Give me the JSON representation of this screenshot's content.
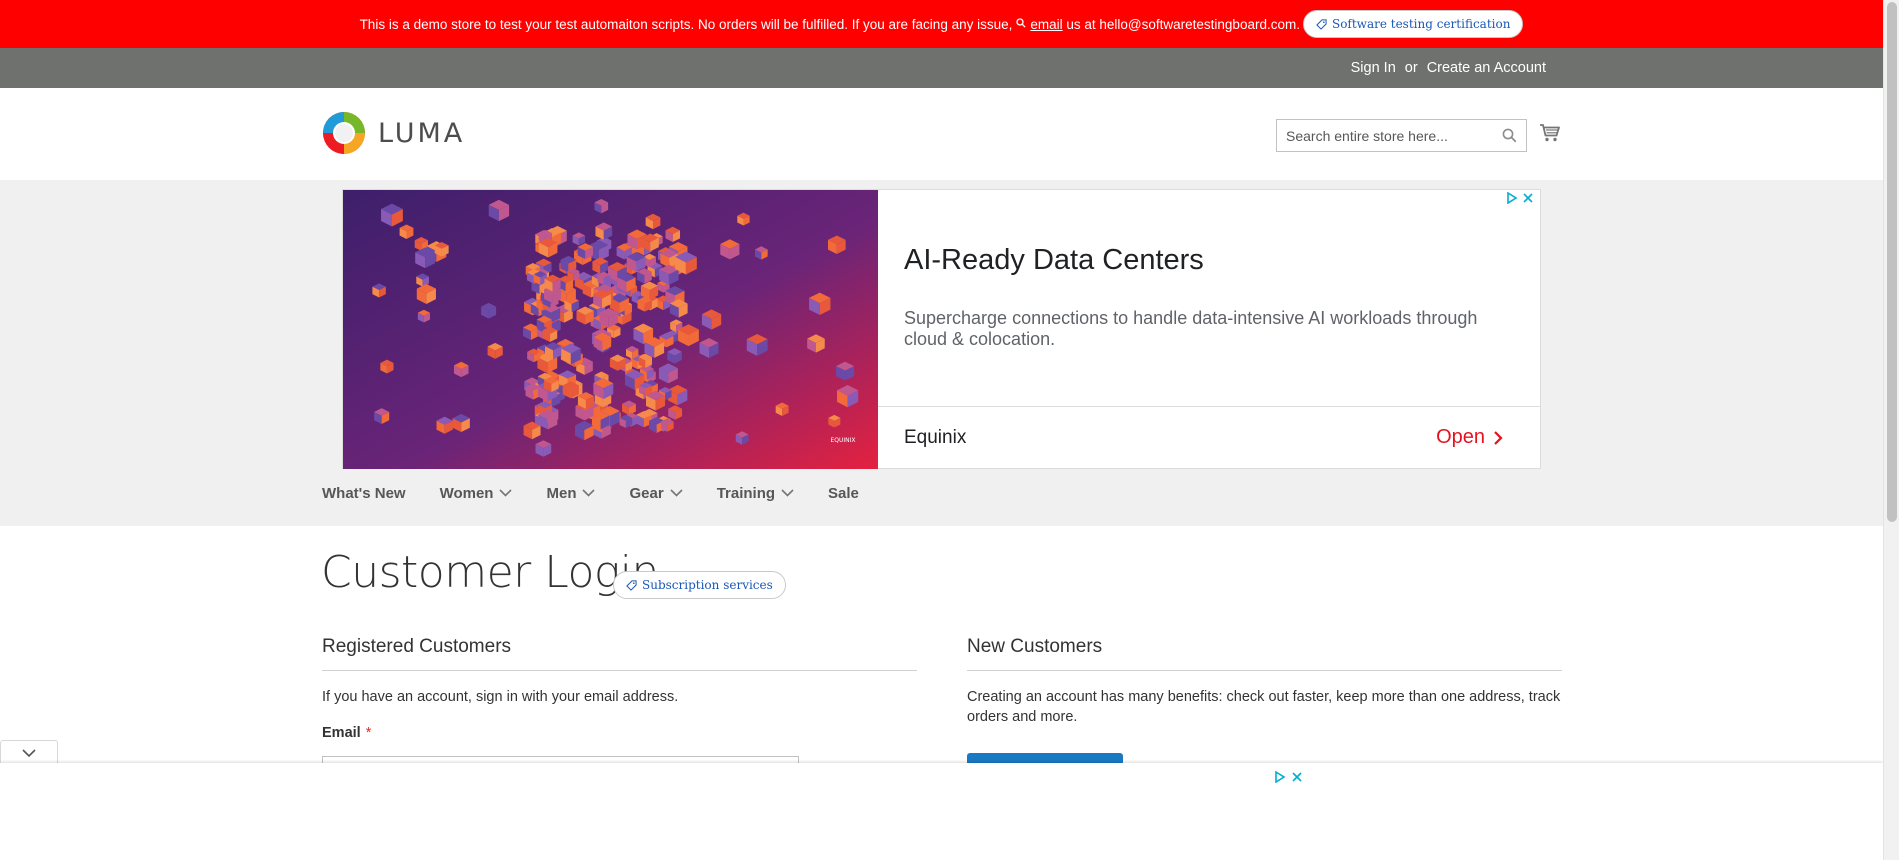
{
  "banner": {
    "message": "This is a demo store to test your test automaiton scripts. No orders will be fulfilled. If you are facing any issue,",
    "email_link": "email",
    "email_text": "us at hello@softwaretestingboard.com.",
    "pill_label": "Software testing certification"
  },
  "account": {
    "sign_in": "Sign In",
    "or": "or",
    "create_account": "Create an Account"
  },
  "header": {
    "logo_text": "LUMA",
    "search_placeholder": "Search entire store here..."
  },
  "ad": {
    "title": "AI-Ready Data Centers",
    "description": "Supercharge connections to handle data-intensive AI workloads through cloud & colocation.",
    "advertiser": "Equinix",
    "cta": "Open",
    "art_logo_text": "EQUINIX"
  },
  "nav": {
    "items": [
      {
        "label": "What's New",
        "has_menu": false
      },
      {
        "label": "Women",
        "has_menu": true
      },
      {
        "label": "Men",
        "has_menu": true
      },
      {
        "label": "Gear",
        "has_menu": true
      },
      {
        "label": "Training",
        "has_menu": true
      },
      {
        "label": "Sale",
        "has_menu": false
      }
    ]
  },
  "main": {
    "title": "Customer Login",
    "title_pill": "Subscription services",
    "registered": {
      "title": "Registered Customers",
      "text": "If you have an account, sign in with your email address.",
      "email_label": "Email",
      "required_mark": "*"
    },
    "new_customers": {
      "title": "New Customers",
      "text": "Creating an account has many benefits: check out faster, keep more than one address, track orders and more."
    }
  },
  "colors": {
    "banner_bg": "#ff0000",
    "account_bar_bg": "#6e716e",
    "band_bg": "#f0f0f0",
    "primary_button": "#1979c3",
    "ad_cta": "#e8101e",
    "adchoices_blue": "#00aecd"
  }
}
